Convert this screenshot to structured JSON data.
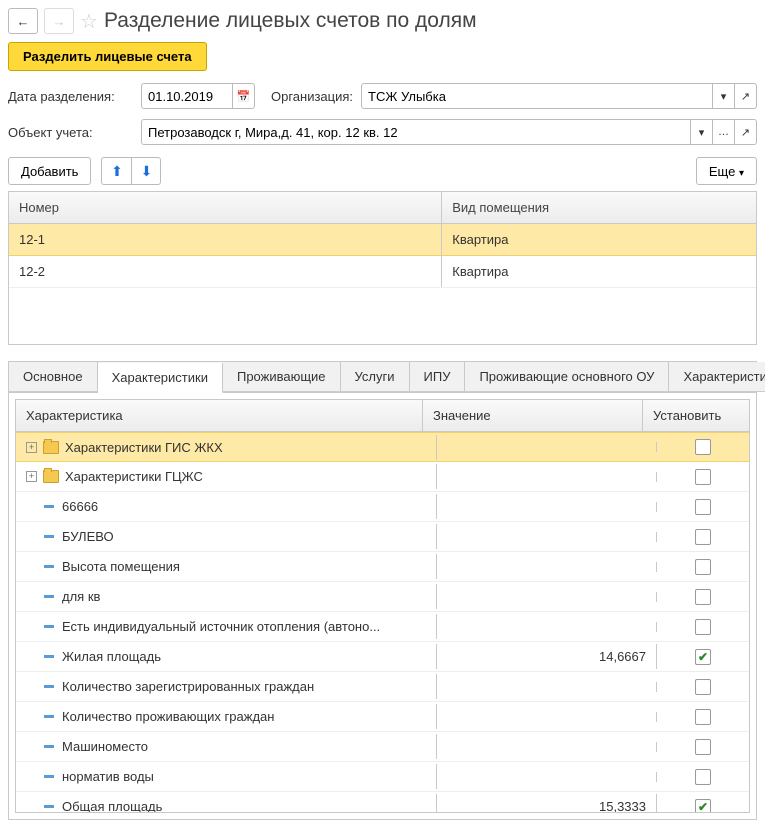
{
  "header": {
    "title": "Разделение лицевых счетов по долям"
  },
  "actions": {
    "split_label": "Разделить лицевые счета",
    "add_label": "Добавить",
    "more_label": "Еще"
  },
  "form": {
    "date_label": "Дата разделения:",
    "date_value": "01.10.2019",
    "org_label": "Организация:",
    "org_value": "ТСЖ Улыбка",
    "obj_label": "Объект учета:",
    "obj_value": "Петрозаводск г, Мира,д. 41, кор. 12 кв. 12"
  },
  "grid1": {
    "col_num": "Номер",
    "col_type": "Вид помещения",
    "rows": [
      {
        "num": "12-1",
        "type": "Квартира"
      },
      {
        "num": "12-2",
        "type": "Квартира"
      }
    ]
  },
  "tabs": {
    "items": [
      "Основное",
      "Характеристики",
      "Проживающие",
      "Услуги",
      "ИПУ",
      "Проживающие основного ОУ",
      "Характеристики ЛС"
    ],
    "active": 1
  },
  "props": {
    "col1": "Характеристика",
    "col2": "Значение",
    "col3": "Установить",
    "rows": [
      {
        "kind": "folder",
        "label": "Характеристики ГИС ЖКХ",
        "value": "",
        "set": false,
        "sel": true
      },
      {
        "kind": "folder",
        "label": "Характеристики ГЦЖС",
        "value": "",
        "set": false
      },
      {
        "kind": "item",
        "label": "66666",
        "value": "",
        "set": false
      },
      {
        "kind": "item",
        "label": "БУЛЕВО",
        "value": "",
        "set": false
      },
      {
        "kind": "item",
        "label": "Высота помещения",
        "value": "",
        "set": false
      },
      {
        "kind": "item",
        "label": "для кв",
        "value": "",
        "set": false
      },
      {
        "kind": "item",
        "label": "Есть индивидуальный источник отопления (автоно...",
        "value": "",
        "set": false
      },
      {
        "kind": "item",
        "label": "Жилая площадь",
        "value": "14,6667",
        "set": true
      },
      {
        "kind": "item",
        "label": "Количество зарегистрированных граждан",
        "value": "",
        "set": false
      },
      {
        "kind": "item",
        "label": "Количество проживающих граждан",
        "value": "",
        "set": false
      },
      {
        "kind": "item",
        "label": "Машиноместо",
        "value": "",
        "set": false
      },
      {
        "kind": "item",
        "label": "норматив воды",
        "value": "",
        "set": false
      },
      {
        "kind": "item",
        "label": "Общая площадь",
        "value": "15,3333",
        "set": true
      }
    ]
  }
}
